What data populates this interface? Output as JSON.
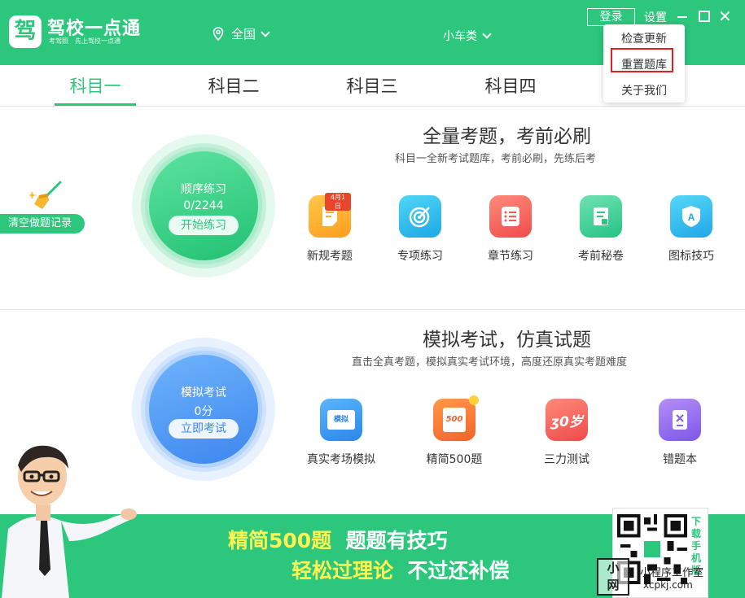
{
  "app": {
    "logo_char": "驾",
    "name": "驾校一点通",
    "slogan": "考驾照　先上驾校一点通"
  },
  "header": {
    "region": "全国",
    "car_type": "小车类",
    "login": "登录",
    "settings": "设置",
    "minimize_icon": "minimize-icon",
    "maximize_icon": "maximize-icon",
    "close_glyph": "✕"
  },
  "menu": {
    "items": [
      "检查更新",
      "重置题库",
      "关于我们"
    ],
    "highlighted": "重置题库"
  },
  "tabs": [
    "科目一",
    "科目二",
    "科目三",
    "科目四"
  ],
  "active_tab": "科目一",
  "sidebar": {
    "clear_record": "清空做题记录"
  },
  "practice": {
    "title": "全量考题，考前必刷",
    "subtitle": "科目一全新考试题库，考前必刷，先练后考",
    "circle": {
      "title": "顺序练习",
      "progress": "0/2244",
      "button": "开始练习"
    },
    "features": [
      {
        "label": "新规考题",
        "badge": "4月1日",
        "icon": "new-rules-icon"
      },
      {
        "label": "专项练习",
        "icon": "target-icon"
      },
      {
        "label": "章节练习",
        "icon": "list-icon"
      },
      {
        "label": "考前秘卷",
        "icon": "scroll-icon"
      },
      {
        "label": "图标技巧",
        "icon": "sign-icon"
      }
    ]
  },
  "exam": {
    "title": "模拟考试，仿真试题",
    "subtitle": "直击全真考题，模拟真实考试环境，高度还原真实考题难度",
    "circle": {
      "title": "模拟考试",
      "score": "0分",
      "button": "立即考试"
    },
    "features": [
      {
        "label": "真实考场模拟",
        "icon_text": "模拟",
        "icon": "monitor-icon"
      },
      {
        "label": "精简500题",
        "icon_text": "500",
        "icon": "clipboard-500-icon"
      },
      {
        "label": "三力测试",
        "icon_text": "ʒ0岁",
        "icon": "ability-test-icon"
      },
      {
        "label": "错题本",
        "icon": "wrong-book-icon"
      }
    ]
  },
  "banner": {
    "part1": "精简500题",
    "part2": "题题有技巧",
    "part3": "轻松过理论",
    "part4": "不过还补偿",
    "qr_side": "下载手机版"
  },
  "watermark": {
    "badge_line1": "小",
    "badge_line2": "网",
    "text": "小程序工作室",
    "url": "xcpkj.com"
  },
  "colors": {
    "brand": "#2cc77d",
    "highlight": "#e02020",
    "banner_yellow": "#fff44f"
  }
}
